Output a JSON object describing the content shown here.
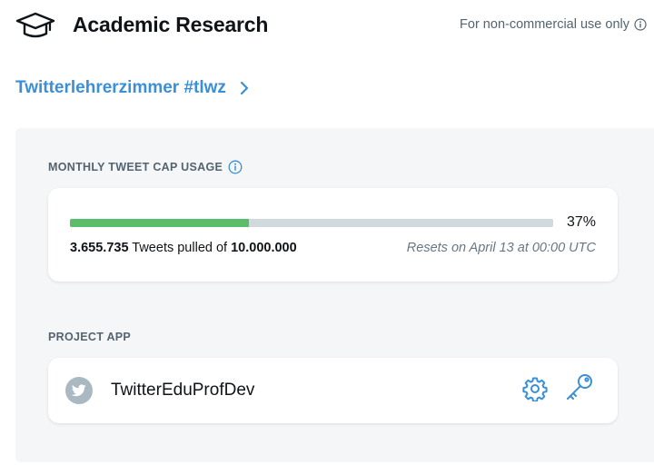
{
  "header": {
    "title": "Academic Research",
    "license_note": "For non-commercial use only",
    "icons": {
      "product": "graduation-cap-icon",
      "info": "info-icon"
    }
  },
  "project": {
    "name": "Twitterlehrerzimmer #tlwz",
    "icon": "chevron-right-icon"
  },
  "usage": {
    "section_label": "MONTHLY TWEET CAP USAGE",
    "percent_text": "37%",
    "fraction": 0.37,
    "pulled_count": "3.655.735",
    "pulled_middle": " Tweets pulled of ",
    "cap": "10.000.000",
    "reset_text": "Resets on April 13 at 00:00 UTC"
  },
  "project_app": {
    "section_label": "PROJECT APP",
    "name": "TwitterEduProfDev",
    "icons": {
      "avatar": "twitter-bird-icon",
      "settings": "gear-icon",
      "keys": "key-icon"
    }
  },
  "colors": {
    "accent": "#3b8fd6",
    "progress": "#5bbd6a",
    "track": "#cfd9de",
    "panel": "#f5f6f7"
  }
}
